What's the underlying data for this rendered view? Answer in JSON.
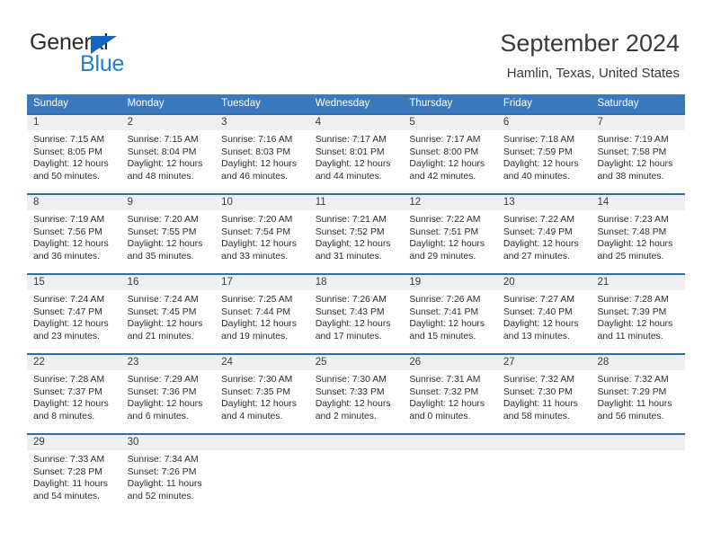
{
  "brand": {
    "name_top": "General",
    "name_bottom": "Blue",
    "accent_color": "#1e7fd4",
    "triangle_color": "#1565c0"
  },
  "header": {
    "title": "September 2024",
    "subtitle": "Hamlin, Texas, United States"
  },
  "theme": {
    "header_bar_color": "#3a79bd",
    "row_divider_color": "#2e6cab",
    "day_band_color": "#efefef",
    "text_color": "#2d2d2d"
  },
  "weekdays": [
    "Sunday",
    "Monday",
    "Tuesday",
    "Wednesday",
    "Thursday",
    "Friday",
    "Saturday"
  ],
  "weeks": [
    [
      {
        "day": "1",
        "sunrise": "Sunrise: 7:15 AM",
        "sunset": "Sunset: 8:05 PM",
        "daylight_1": "Daylight: 12 hours",
        "daylight_2": "and 50 minutes."
      },
      {
        "day": "2",
        "sunrise": "Sunrise: 7:15 AM",
        "sunset": "Sunset: 8:04 PM",
        "daylight_1": "Daylight: 12 hours",
        "daylight_2": "and 48 minutes."
      },
      {
        "day": "3",
        "sunrise": "Sunrise: 7:16 AM",
        "sunset": "Sunset: 8:03 PM",
        "daylight_1": "Daylight: 12 hours",
        "daylight_2": "and 46 minutes."
      },
      {
        "day": "4",
        "sunrise": "Sunrise: 7:17 AM",
        "sunset": "Sunset: 8:01 PM",
        "daylight_1": "Daylight: 12 hours",
        "daylight_2": "and 44 minutes."
      },
      {
        "day": "5",
        "sunrise": "Sunrise: 7:17 AM",
        "sunset": "Sunset: 8:00 PM",
        "daylight_1": "Daylight: 12 hours",
        "daylight_2": "and 42 minutes."
      },
      {
        "day": "6",
        "sunrise": "Sunrise: 7:18 AM",
        "sunset": "Sunset: 7:59 PM",
        "daylight_1": "Daylight: 12 hours",
        "daylight_2": "and 40 minutes."
      },
      {
        "day": "7",
        "sunrise": "Sunrise: 7:19 AM",
        "sunset": "Sunset: 7:58 PM",
        "daylight_1": "Daylight: 12 hours",
        "daylight_2": "and 38 minutes."
      }
    ],
    [
      {
        "day": "8",
        "sunrise": "Sunrise: 7:19 AM",
        "sunset": "Sunset: 7:56 PM",
        "daylight_1": "Daylight: 12 hours",
        "daylight_2": "and 36 minutes."
      },
      {
        "day": "9",
        "sunrise": "Sunrise: 7:20 AM",
        "sunset": "Sunset: 7:55 PM",
        "daylight_1": "Daylight: 12 hours",
        "daylight_2": "and 35 minutes."
      },
      {
        "day": "10",
        "sunrise": "Sunrise: 7:20 AM",
        "sunset": "Sunset: 7:54 PM",
        "daylight_1": "Daylight: 12 hours",
        "daylight_2": "and 33 minutes."
      },
      {
        "day": "11",
        "sunrise": "Sunrise: 7:21 AM",
        "sunset": "Sunset: 7:52 PM",
        "daylight_1": "Daylight: 12 hours",
        "daylight_2": "and 31 minutes."
      },
      {
        "day": "12",
        "sunrise": "Sunrise: 7:22 AM",
        "sunset": "Sunset: 7:51 PM",
        "daylight_1": "Daylight: 12 hours",
        "daylight_2": "and 29 minutes."
      },
      {
        "day": "13",
        "sunrise": "Sunrise: 7:22 AM",
        "sunset": "Sunset: 7:49 PM",
        "daylight_1": "Daylight: 12 hours",
        "daylight_2": "and 27 minutes."
      },
      {
        "day": "14",
        "sunrise": "Sunrise: 7:23 AM",
        "sunset": "Sunset: 7:48 PM",
        "daylight_1": "Daylight: 12 hours",
        "daylight_2": "and 25 minutes."
      }
    ],
    [
      {
        "day": "15",
        "sunrise": "Sunrise: 7:24 AM",
        "sunset": "Sunset: 7:47 PM",
        "daylight_1": "Daylight: 12 hours",
        "daylight_2": "and 23 minutes."
      },
      {
        "day": "16",
        "sunrise": "Sunrise: 7:24 AM",
        "sunset": "Sunset: 7:45 PM",
        "daylight_1": "Daylight: 12 hours",
        "daylight_2": "and 21 minutes."
      },
      {
        "day": "17",
        "sunrise": "Sunrise: 7:25 AM",
        "sunset": "Sunset: 7:44 PM",
        "daylight_1": "Daylight: 12 hours",
        "daylight_2": "and 19 minutes."
      },
      {
        "day": "18",
        "sunrise": "Sunrise: 7:26 AM",
        "sunset": "Sunset: 7:43 PM",
        "daylight_1": "Daylight: 12 hours",
        "daylight_2": "and 17 minutes."
      },
      {
        "day": "19",
        "sunrise": "Sunrise: 7:26 AM",
        "sunset": "Sunset: 7:41 PM",
        "daylight_1": "Daylight: 12 hours",
        "daylight_2": "and 15 minutes."
      },
      {
        "day": "20",
        "sunrise": "Sunrise: 7:27 AM",
        "sunset": "Sunset: 7:40 PM",
        "daylight_1": "Daylight: 12 hours",
        "daylight_2": "and 13 minutes."
      },
      {
        "day": "21",
        "sunrise": "Sunrise: 7:28 AM",
        "sunset": "Sunset: 7:39 PM",
        "daylight_1": "Daylight: 12 hours",
        "daylight_2": "and 11 minutes."
      }
    ],
    [
      {
        "day": "22",
        "sunrise": "Sunrise: 7:28 AM",
        "sunset": "Sunset: 7:37 PM",
        "daylight_1": "Daylight: 12 hours",
        "daylight_2": "and 8 minutes."
      },
      {
        "day": "23",
        "sunrise": "Sunrise: 7:29 AM",
        "sunset": "Sunset: 7:36 PM",
        "daylight_1": "Daylight: 12 hours",
        "daylight_2": "and 6 minutes."
      },
      {
        "day": "24",
        "sunrise": "Sunrise: 7:30 AM",
        "sunset": "Sunset: 7:35 PM",
        "daylight_1": "Daylight: 12 hours",
        "daylight_2": "and 4 minutes."
      },
      {
        "day": "25",
        "sunrise": "Sunrise: 7:30 AM",
        "sunset": "Sunset: 7:33 PM",
        "daylight_1": "Daylight: 12 hours",
        "daylight_2": "and 2 minutes."
      },
      {
        "day": "26",
        "sunrise": "Sunrise: 7:31 AM",
        "sunset": "Sunset: 7:32 PM",
        "daylight_1": "Daylight: 12 hours",
        "daylight_2": "and 0 minutes."
      },
      {
        "day": "27",
        "sunrise": "Sunrise: 7:32 AM",
        "sunset": "Sunset: 7:30 PM",
        "daylight_1": "Daylight: 11 hours",
        "daylight_2": "and 58 minutes."
      },
      {
        "day": "28",
        "sunrise": "Sunrise: 7:32 AM",
        "sunset": "Sunset: 7:29 PM",
        "daylight_1": "Daylight: 11 hours",
        "daylight_2": "and 56 minutes."
      }
    ],
    [
      {
        "day": "29",
        "sunrise": "Sunrise: 7:33 AM",
        "sunset": "Sunset: 7:28 PM",
        "daylight_1": "Daylight: 11 hours",
        "daylight_2": "and 54 minutes."
      },
      {
        "day": "30",
        "sunrise": "Sunrise: 7:34 AM",
        "sunset": "Sunset: 7:26 PM",
        "daylight_1": "Daylight: 11 hours",
        "daylight_2": "and 52 minutes."
      },
      {
        "day": "",
        "sunrise": "",
        "sunset": "",
        "daylight_1": "",
        "daylight_2": ""
      },
      {
        "day": "",
        "sunrise": "",
        "sunset": "",
        "daylight_1": "",
        "daylight_2": ""
      },
      {
        "day": "",
        "sunrise": "",
        "sunset": "",
        "daylight_1": "",
        "daylight_2": ""
      },
      {
        "day": "",
        "sunrise": "",
        "sunset": "",
        "daylight_1": "",
        "daylight_2": ""
      },
      {
        "day": "",
        "sunrise": "",
        "sunset": "",
        "daylight_1": "",
        "daylight_2": ""
      }
    ]
  ]
}
